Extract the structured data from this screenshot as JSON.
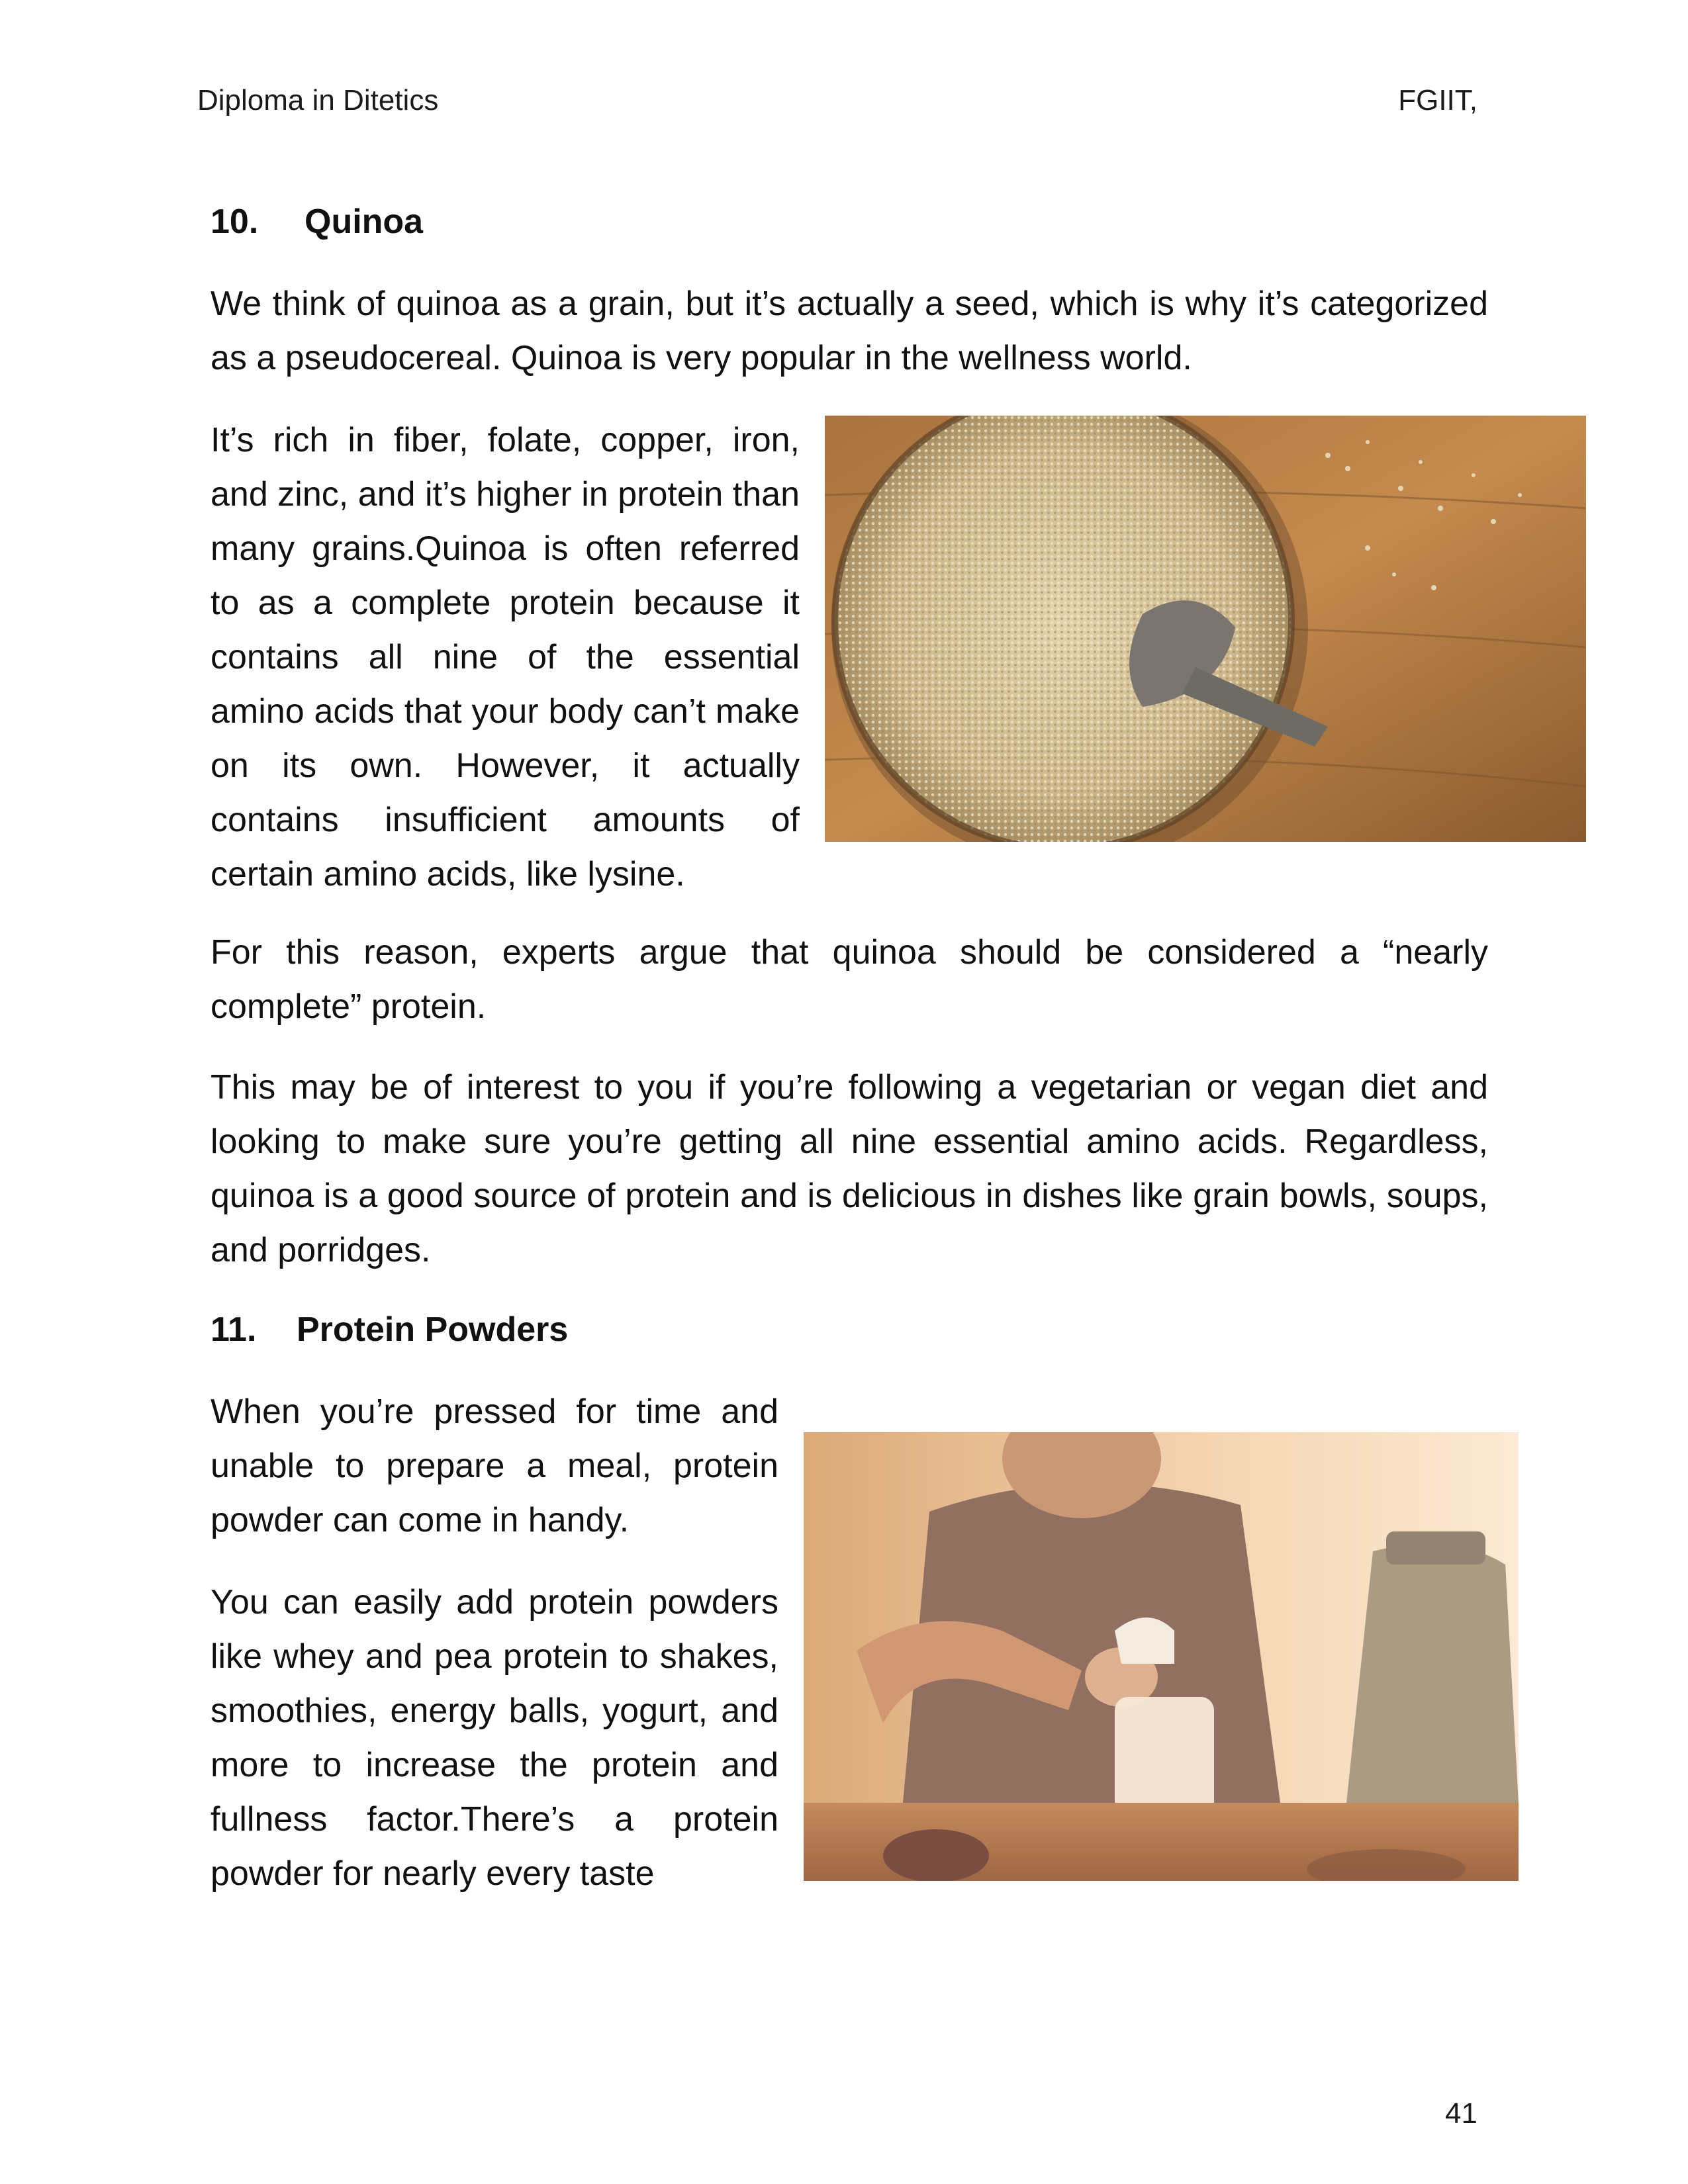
{
  "header": {
    "left": "Diploma in Ditetics",
    "right": "FGIIT,"
  },
  "section10": {
    "number": "10.",
    "title": "Quinoa",
    "para1": "We think of quinoa as a grain, but it’s actually a seed, which is why it’s categorized as a pseudocereal. Quinoa is very popular in the wellness world.",
    "para2": "It’s rich in fiber, folate, copper, iron, and zinc, and it’s higher in protein than many grains.Quinoa is often referred to as a complete protein because it contains all nine of the essential amino acids that your body can’t make on its own. However, it actually contains insufficient amounts of certain amino acids, like lysine.",
    "para3": "For this reason, experts argue that quinoa should be considered a “nearly complete” protein.",
    "para4": "This may be of interest to you if you’re following a vegetarian or vegan diet and looking to make sure you’re getting all nine essential amino acids. Regardless, quinoa is a good source of protein and is delicious in dishes like grain bowls, soups, and porridges."
  },
  "section11": {
    "number": "11.",
    "title": "Protein Powders",
    "para1": "When you’re pressed for time and unable to prepare a meal, protein powder can come in handy.",
    "para2": "You can easily add protein powders like whey and pea protein to shakes, smoothies, energy balls, yogurt, and more to increase the protein and fullness factor.There’s a protein powder for nearly every taste"
  },
  "page_number": "41"
}
